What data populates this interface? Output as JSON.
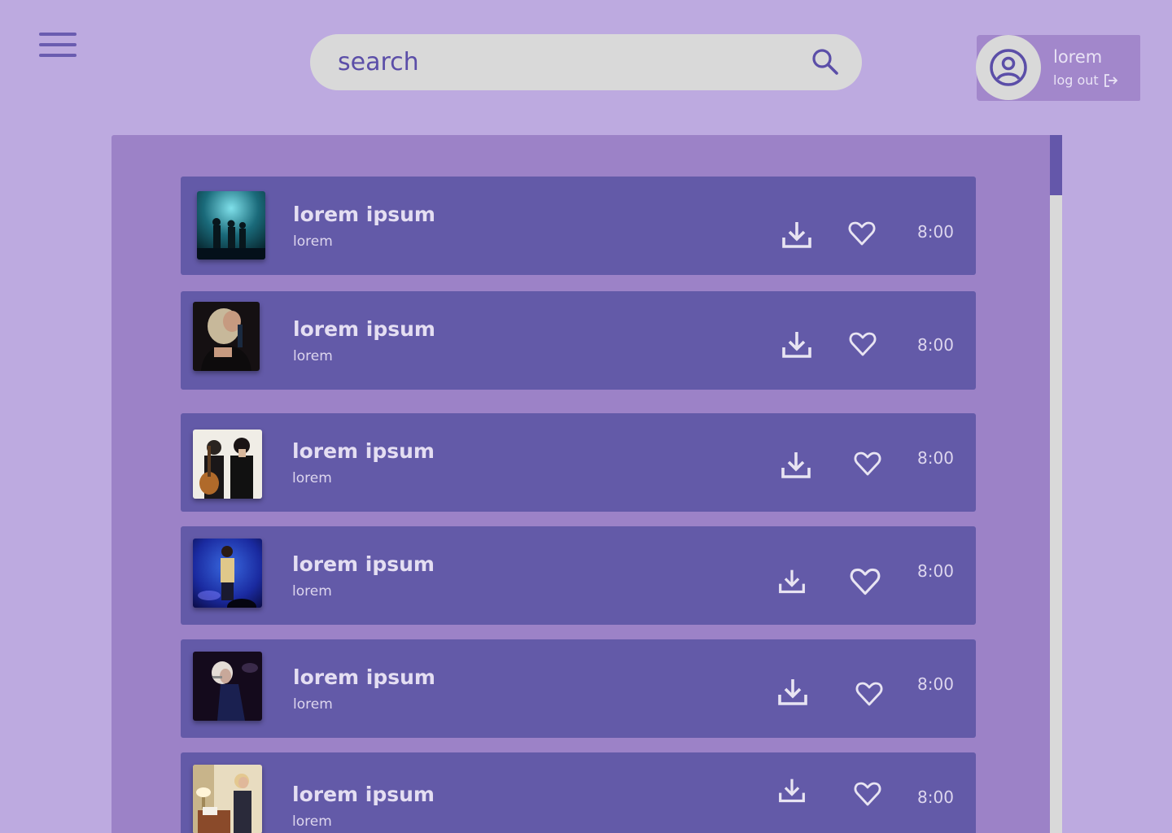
{
  "header": {
    "search_placeholder": "search",
    "user": {
      "name": "lorem",
      "logout_label": "log out"
    }
  },
  "tracks": [
    {
      "title": "lorem ipsum",
      "artist": "lorem",
      "duration": "8:00"
    },
    {
      "title": "lorem ipsum",
      "artist": "lorem",
      "duration": "8:00"
    },
    {
      "title": "lorem ipsum",
      "artist": "lorem",
      "duration": "8:00"
    },
    {
      "title": "lorem ipsum",
      "artist": "lorem",
      "duration": "8:00"
    },
    {
      "title": "lorem ipsum",
      "artist": "lorem",
      "duration": "8:00"
    },
    {
      "title": "lorem ipsum",
      "artist": "lorem",
      "duration": "8:00"
    }
  ],
  "colors": {
    "background": "#bdaae0",
    "panel": "#9c82c7",
    "row": "#635aa8",
    "accent": "#5b4ea8",
    "search_bg": "#d9d9d9"
  },
  "icons": [
    "menu-icon",
    "search-icon",
    "user-circle-icon",
    "logout-icon",
    "download-icon",
    "heart-icon"
  ]
}
